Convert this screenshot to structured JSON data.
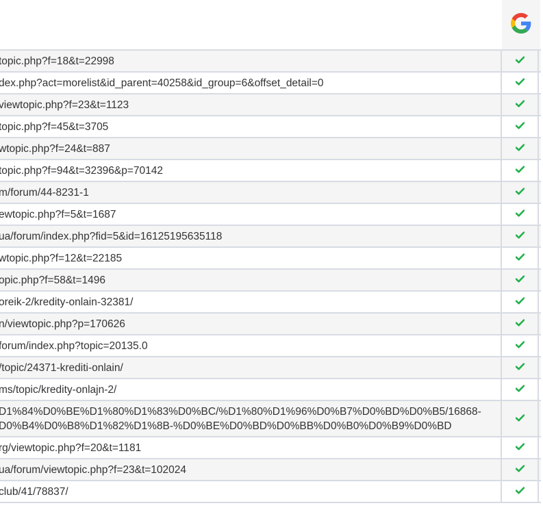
{
  "header": {
    "engine_icon": "google-g-icon"
  },
  "colors": {
    "check": "#22b14c",
    "border": "#d7dbe3",
    "row_alt": "#f5f5f5",
    "text": "#333333"
  },
  "rows": [
    {
      "url": "topic.php?f=18&t=22998",
      "indexed_icon": "checkmark-icon"
    },
    {
      "url": "dex.php?act=morelist&id_parent=40258&id_group=6&offset_detail=0",
      "indexed_icon": "checkmark-icon"
    },
    {
      "url": "viewtopic.php?f=23&t=1123",
      "indexed_icon": "checkmark-icon"
    },
    {
      "url": "topic.php?f=45&t=3705",
      "indexed_icon": "checkmark-icon"
    },
    {
      "url": "wtopic.php?f=24&t=887",
      "indexed_icon": "checkmark-icon"
    },
    {
      "url": "topic.php?f=94&t=32396&p=70142",
      "indexed_icon": "checkmark-icon"
    },
    {
      "url": "m/forum/44-8231-1",
      "indexed_icon": "checkmark-icon"
    },
    {
      "url": "ewtopic.php?f=5&t=1687",
      "indexed_icon": "checkmark-icon"
    },
    {
      "url": "ua/forum/index.php?fid=5&id=16125195635118",
      "indexed_icon": "checkmark-icon"
    },
    {
      "url": "wtopic.php?f=12&t=22185",
      "indexed_icon": "checkmark-icon"
    },
    {
      "url": "opic.php?f=58&t=1496",
      "indexed_icon": "checkmark-icon"
    },
    {
      "url": "oreik-2/kredity-onlain-32381/",
      "indexed_icon": "checkmark-icon"
    },
    {
      "url": "n/viewtopic.php?p=170626",
      "indexed_icon": "checkmark-icon"
    },
    {
      "url": "forum/index.php?topic=20135.0",
      "indexed_icon": "checkmark-icon"
    },
    {
      "url": "/topic/24371-krediti-onlain/",
      "indexed_icon": "checkmark-icon"
    },
    {
      "url": "ms/topic/kredity-onlajn-2/",
      "indexed_icon": "checkmark-icon"
    },
    {
      "url": "D1%84%D0%BE%D1%80%D1%83%D0%BC/%D1%80%D1%96%D0%B7%D0%BD%D0%B5/16868-\nD0%B4%D0%B8%D1%82%D1%8B-%D0%BE%D0%BD%D0%BB%D0%B0%D0%B9%D0%BD",
      "indexed_icon": "checkmark-icon"
    },
    {
      "url": "rg/viewtopic.php?f=20&t=1181",
      "indexed_icon": "checkmark-icon"
    },
    {
      "url": "ua/forum/viewtopic.php?f=23&t=102024",
      "indexed_icon": "checkmark-icon"
    },
    {
      "url": "club/41/78837/",
      "indexed_icon": "checkmark-icon"
    }
  ]
}
